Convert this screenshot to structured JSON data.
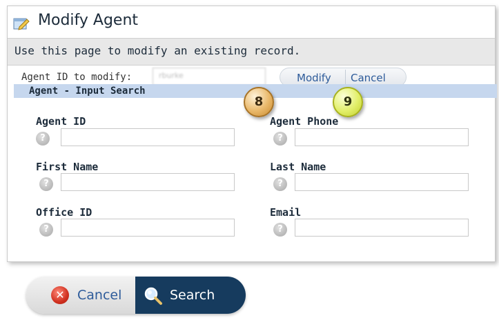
{
  "header": {
    "title": "Modify Agent",
    "title_icon": "edit-document-icon",
    "subtitle": "Use this page to modify an existing record."
  },
  "modify_bar": {
    "label": "Agent ID to modify:",
    "input_value": "rburke",
    "modify_label": "Modify",
    "cancel_label": "Cancel"
  },
  "section": {
    "title": "Agent - Input Search"
  },
  "callouts": {
    "eight": "8",
    "nine": "9"
  },
  "fields": {
    "agent_id": {
      "label": "Agent ID",
      "value": ""
    },
    "agent_phone": {
      "label": "Agent Phone",
      "value": ""
    },
    "first_name": {
      "label": "First Name",
      "value": ""
    },
    "last_name": {
      "label": "Last Name",
      "value": ""
    },
    "office_id": {
      "label": "Office ID",
      "value": ""
    },
    "email": {
      "label": "Email",
      "value": ""
    }
  },
  "help_glyph": "?",
  "footer": {
    "cancel_label": "Cancel",
    "cancel_icon": "close-circle-icon",
    "search_label": "Search",
    "search_icon": "magnifier-icon"
  },
  "colors": {
    "section_header": "#c6d7ee",
    "search_button": "#163b5e",
    "link_blue": "#2d5b9a",
    "callout_8": "#e9b86a",
    "callout_9": "#e2ef6a"
  }
}
